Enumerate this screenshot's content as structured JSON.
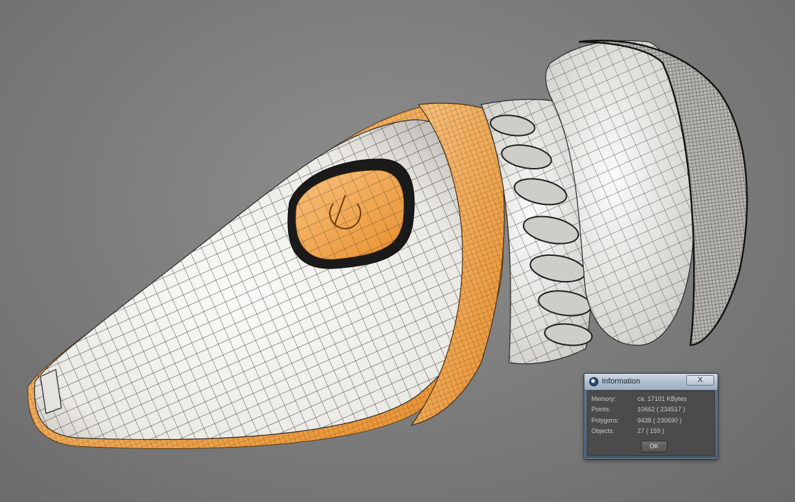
{
  "dialog": {
    "title": "Information",
    "close_label": "X",
    "ok_label": "OK",
    "rows": [
      {
        "label": "Memory:",
        "value": "ca. 17101 KBytes"
      },
      {
        "label": "Points:",
        "value": "10662 ( 234517 )"
      },
      {
        "label": "Polygons:",
        "value": "9438 ( 230690 )"
      },
      {
        "label": "Objects:",
        "value": "27 ( 159 )"
      }
    ]
  },
  "colors": {
    "background": "#7e7e7e",
    "model_shell": "#f1f0ec",
    "accent_orange": "#f2a54a",
    "wire": "#1c1c1c",
    "dialog_title": "#aebdcc"
  },
  "icons": {
    "app": "cinema4d-icon",
    "power": "power-icon"
  }
}
